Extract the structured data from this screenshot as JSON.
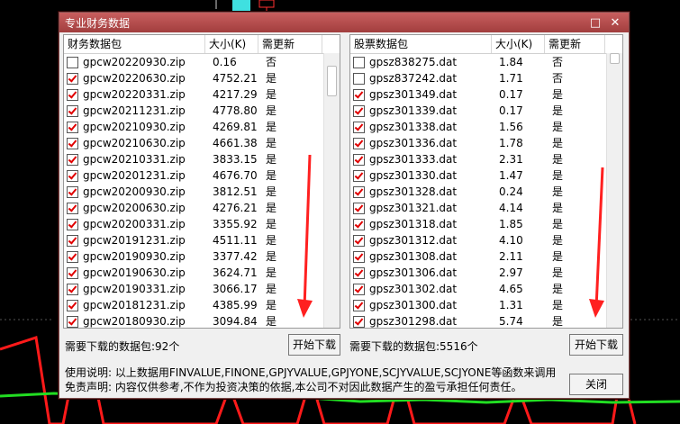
{
  "window": {
    "title": "专业财务数据",
    "minimize_glyph": "□",
    "close_glyph": "✕"
  },
  "left": {
    "columns": [
      "财务数据包",
      "大小(K)",
      "需更新"
    ],
    "rows": [
      {
        "name": "gpcw20220930.zip",
        "size": "0.16",
        "update": "否",
        "checked": false
      },
      {
        "name": "gpcw20220630.zip",
        "size": "4752.21",
        "update": "是",
        "checked": true
      },
      {
        "name": "gpcw20220331.zip",
        "size": "4217.29",
        "update": "是",
        "checked": true
      },
      {
        "name": "gpcw20211231.zip",
        "size": "4778.80",
        "update": "是",
        "checked": true
      },
      {
        "name": "gpcw20210930.zip",
        "size": "4269.81",
        "update": "是",
        "checked": true
      },
      {
        "name": "gpcw20210630.zip",
        "size": "4661.38",
        "update": "是",
        "checked": true
      },
      {
        "name": "gpcw20210331.zip",
        "size": "3833.15",
        "update": "是",
        "checked": true
      },
      {
        "name": "gpcw20201231.zip",
        "size": "4676.70",
        "update": "是",
        "checked": true
      },
      {
        "name": "gpcw20200930.zip",
        "size": "3812.51",
        "update": "是",
        "checked": true
      },
      {
        "name": "gpcw20200630.zip",
        "size": "4276.21",
        "update": "是",
        "checked": true
      },
      {
        "name": "gpcw20200331.zip",
        "size": "3355.92",
        "update": "是",
        "checked": true
      },
      {
        "name": "gpcw20191231.zip",
        "size": "4511.11",
        "update": "是",
        "checked": true
      },
      {
        "name": "gpcw20190930.zip",
        "size": "3377.42",
        "update": "是",
        "checked": true
      },
      {
        "name": "gpcw20190630.zip",
        "size": "3624.71",
        "update": "是",
        "checked": true
      },
      {
        "name": "gpcw20190331.zip",
        "size": "3066.17",
        "update": "是",
        "checked": true
      },
      {
        "name": "gpcw20181231.zip",
        "size": "4385.99",
        "update": "是",
        "checked": true
      },
      {
        "name": "gpcw20180930.zip",
        "size": "3094.84",
        "update": "是",
        "checked": true
      }
    ],
    "status": "需要下载的数据包:92个",
    "download_label": "开始下载"
  },
  "right": {
    "columns": [
      "股票数据包",
      "大小(K)",
      "需更新"
    ],
    "rows": [
      {
        "name": "gpsz838275.dat",
        "size": "1.84",
        "update": "否",
        "checked": false
      },
      {
        "name": "gpsz837242.dat",
        "size": "1.71",
        "update": "否",
        "checked": false
      },
      {
        "name": "gpsz301349.dat",
        "size": "0.17",
        "update": "是",
        "checked": true
      },
      {
        "name": "gpsz301339.dat",
        "size": "0.17",
        "update": "是",
        "checked": true
      },
      {
        "name": "gpsz301338.dat",
        "size": "1.56",
        "update": "是",
        "checked": true
      },
      {
        "name": "gpsz301336.dat",
        "size": "1.78",
        "update": "是",
        "checked": true
      },
      {
        "name": "gpsz301333.dat",
        "size": "2.31",
        "update": "是",
        "checked": true
      },
      {
        "name": "gpsz301330.dat",
        "size": "1.47",
        "update": "是",
        "checked": true
      },
      {
        "name": "gpsz301328.dat",
        "size": "0.24",
        "update": "是",
        "checked": true
      },
      {
        "name": "gpsz301321.dat",
        "size": "4.14",
        "update": "是",
        "checked": true
      },
      {
        "name": "gpsz301318.dat",
        "size": "1.85",
        "update": "是",
        "checked": true
      },
      {
        "name": "gpsz301312.dat",
        "size": "4.10",
        "update": "是",
        "checked": true
      },
      {
        "name": "gpsz301308.dat",
        "size": "2.11",
        "update": "是",
        "checked": true
      },
      {
        "name": "gpsz301306.dat",
        "size": "2.97",
        "update": "是",
        "checked": true
      },
      {
        "name": "gpsz301302.dat",
        "size": "4.65",
        "update": "是",
        "checked": true
      },
      {
        "name": "gpsz301300.dat",
        "size": "1.31",
        "update": "是",
        "checked": true
      },
      {
        "name": "gpsz301298.dat",
        "size": "5.74",
        "update": "是",
        "checked": true
      }
    ],
    "status": "需要下载的数据包:5516个",
    "download_label": "开始下载"
  },
  "footer": {
    "usage": "使用说明: 以上数据用FINVALUE,FINONE,GPJYVALUE,GPJYONE,SCJYVALUE,SCJYONE等函数来调用",
    "disclaimer": "免责声明: 内容仅供参考,不作为投资决策的依据,本公司不对因此数据产生的盈亏承担任何责任。",
    "close_label": "关闭"
  },
  "colors": {
    "title_bar": "#b04a4a",
    "check_mark": "#e00000",
    "annotation_arrow": "#ff2020",
    "chart_red": "#ff1a1a",
    "chart_green": "#22dd22"
  }
}
